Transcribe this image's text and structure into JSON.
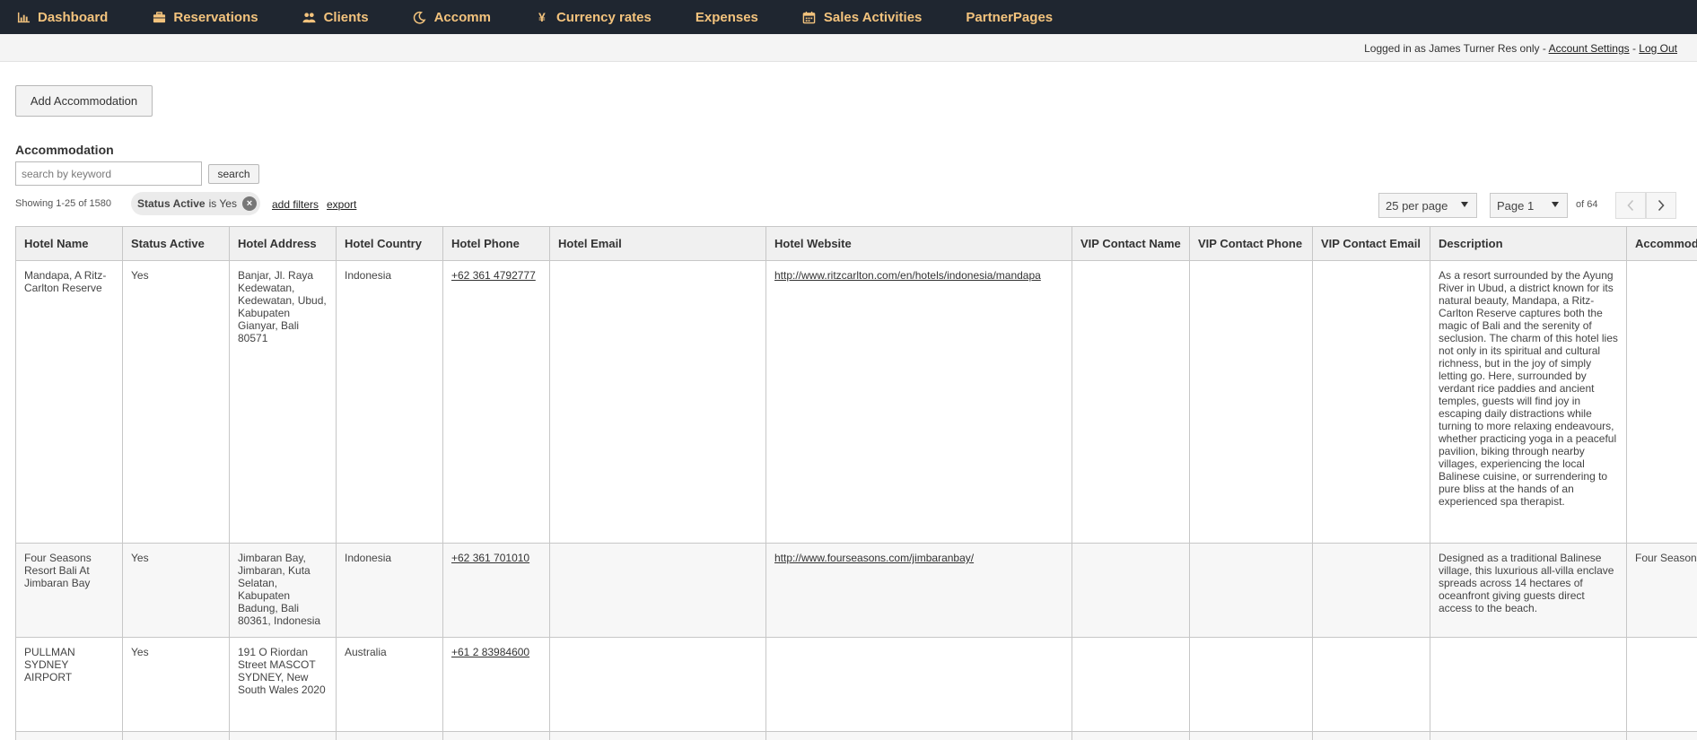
{
  "nav": {
    "items": [
      {
        "label": "Dashboard",
        "icon": "bar-chart-icon"
      },
      {
        "label": "Reservations",
        "icon": "briefcase-icon"
      },
      {
        "label": "Clients",
        "icon": "users-icon"
      },
      {
        "label": "Accomm",
        "icon": "moon-icon"
      },
      {
        "label": "Currency rates",
        "icon": "yen-icon"
      },
      {
        "label": "Expenses",
        "icon": ""
      },
      {
        "label": "Sales Activities",
        "icon": "calendar-icon"
      },
      {
        "label": "PartnerPages",
        "icon": ""
      }
    ]
  },
  "userbar": {
    "logged_in_text": "Logged in as James Turner Res only - ",
    "account_settings": "Account Settings",
    "separator": " - ",
    "logout": "Log Out"
  },
  "add_button": "Add Accommodation",
  "section_title": "Accommodation",
  "search": {
    "placeholder": "search by keyword",
    "button": "search"
  },
  "showing": "Showing 1-25 of 1580",
  "filter": {
    "field": "Status Active",
    "text": "is Yes"
  },
  "add_filters": "add filters",
  "export": "export",
  "pagination": {
    "per_page": "25 per page",
    "page": "Page 1",
    "of_pages": "of 64"
  },
  "table": {
    "headers": [
      "Hotel Name",
      "Status Active",
      "Hotel Address",
      "Hotel Country",
      "Hotel Phone",
      "Hotel Email",
      "Hotel Website",
      "VIP Contact Name",
      "VIP Contact Phone",
      "VIP Contact Email",
      "Description",
      "Accommod"
    ],
    "rows": [
      {
        "name": "Mandapa, A Ritz-Carlton Reserve",
        "status": "Yes",
        "address": "Banjar, Jl. Raya Kedewatan, Kedewatan, Ubud, Kabupaten Gianyar, Bali 80571",
        "country": "Indonesia",
        "phone": "+62 361 4792777",
        "email": "",
        "website": "http://www.ritzcarlton.com/en/hotels/indonesia/mandapa",
        "vip_name": "",
        "vip_phone": "",
        "vip_email": "",
        "description": "As a resort surrounded by the Ayung River in Ubud, a district known for its natural beauty, Mandapa, a Ritz-Carlton Reserve captures both the magic of Bali and the serenity of seclusion. The charm of this hotel lies not only in its spiritual and cultural richness, but in the joy of simply letting go. Here, surrounded by verdant rice paddies and ancient temples, guests will find joy in escaping daily distractions while turning to more relaxing endeavours, whether practicing yoga in a peaceful pavilion, biking through nearby villages, experiencing the local Balinese cuisine, or surrendering to pure bliss at the hands of an experienced spa therapist.",
        "accommodation": ""
      },
      {
        "name": "Four Seasons Resort Bali At Jimbaran Bay",
        "status": "Yes",
        "address": "Jimbaran Bay, Jimbaran, Kuta Selatan, Kabupaten Badung, Bali 80361, Indonesia",
        "country": "Indonesia",
        "phone": "+62 361 701010",
        "email": "",
        "website": "http://www.fourseasons.com/jimbaranbay/",
        "vip_name": "",
        "vip_phone": "",
        "vip_email": "",
        "description": "Designed as a traditional Balinese village, this luxurious all-villa enclave spreads across 14 hectares of oceanfront giving guests direct access to the beach.",
        "accommodation": "Four Seasons"
      },
      {
        "name": "PULLMAN SYDNEY AIRPORT",
        "status": "Yes",
        "address": "191 O Riordan Street MASCOT SYDNEY, New South Wales 2020",
        "country": "Australia",
        "phone": "+61 2 83984600",
        "email": "",
        "website": "",
        "vip_name": "",
        "vip_phone": "",
        "vip_email": "",
        "description": "",
        "accommodation": ""
      }
    ]
  }
}
